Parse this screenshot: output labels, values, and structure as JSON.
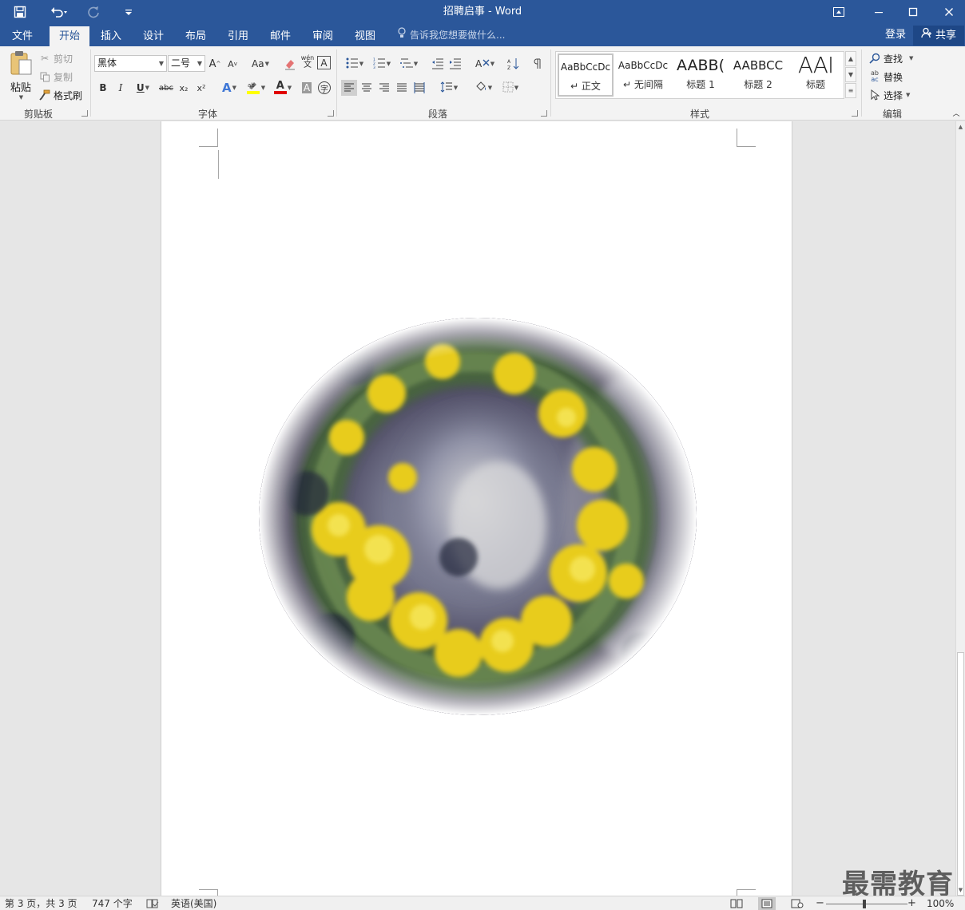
{
  "window": {
    "title": "招聘启事 - Word",
    "quick_access": {
      "save_icon": "save-icon",
      "undo_icon": "undo-icon",
      "redo_icon": "redo-icon",
      "customize_icon": "customize-qat-icon"
    }
  },
  "tabs": [
    {
      "label": "文件"
    },
    {
      "label": "开始"
    },
    {
      "label": "插入"
    },
    {
      "label": "设计"
    },
    {
      "label": "布局"
    },
    {
      "label": "引用"
    },
    {
      "label": "邮件"
    },
    {
      "label": "审阅"
    },
    {
      "label": "视图"
    }
  ],
  "active_tab": "开始",
  "tell_me": "告诉我您想要做什么...",
  "account": {
    "login": "登录",
    "share": "共享"
  },
  "clipboard": {
    "group_label": "剪贴板",
    "paste": "粘贴",
    "cut": "剪切",
    "copy": "复制",
    "format_painter": "格式刷"
  },
  "font": {
    "group_label": "字体",
    "font_name": "黑体",
    "font_size": "二号",
    "bold": "B",
    "italic": "I",
    "underline": "U",
    "strike": "abc",
    "subscript": "x₂",
    "superscript": "x²",
    "change_case": "Aa",
    "grow": "A",
    "shrink": "A",
    "phonetic": "wén",
    "border_char": "A",
    "font_color_letter": "A",
    "shading_letter": "A",
    "enclose": "字"
  },
  "paragraph": {
    "group_label": "段落"
  },
  "styles": {
    "group_label": "样式",
    "items": [
      {
        "sample": "AaBbCcDc",
        "name": "正文"
      },
      {
        "sample": "AaBbCcDc",
        "name": "无间隔"
      },
      {
        "sample": "AABB(",
        "name": "标题 1"
      },
      {
        "sample": "AABBCC",
        "name": "标题 2"
      },
      {
        "sample": "AAI",
        "name": "标题"
      }
    ]
  },
  "editing": {
    "group_label": "编辑",
    "find": "查找",
    "replace": "替换",
    "select": "选择"
  },
  "status": {
    "page": "第 3 页，共 3 页",
    "words": "747 个字",
    "language": "英语(美国)",
    "zoom": "100%"
  },
  "zoom_level": 100,
  "watermark": "最需教育",
  "colors": {
    "accent": "#2b579a",
    "highlight": "#ffff00",
    "font_color": "#e00000"
  }
}
